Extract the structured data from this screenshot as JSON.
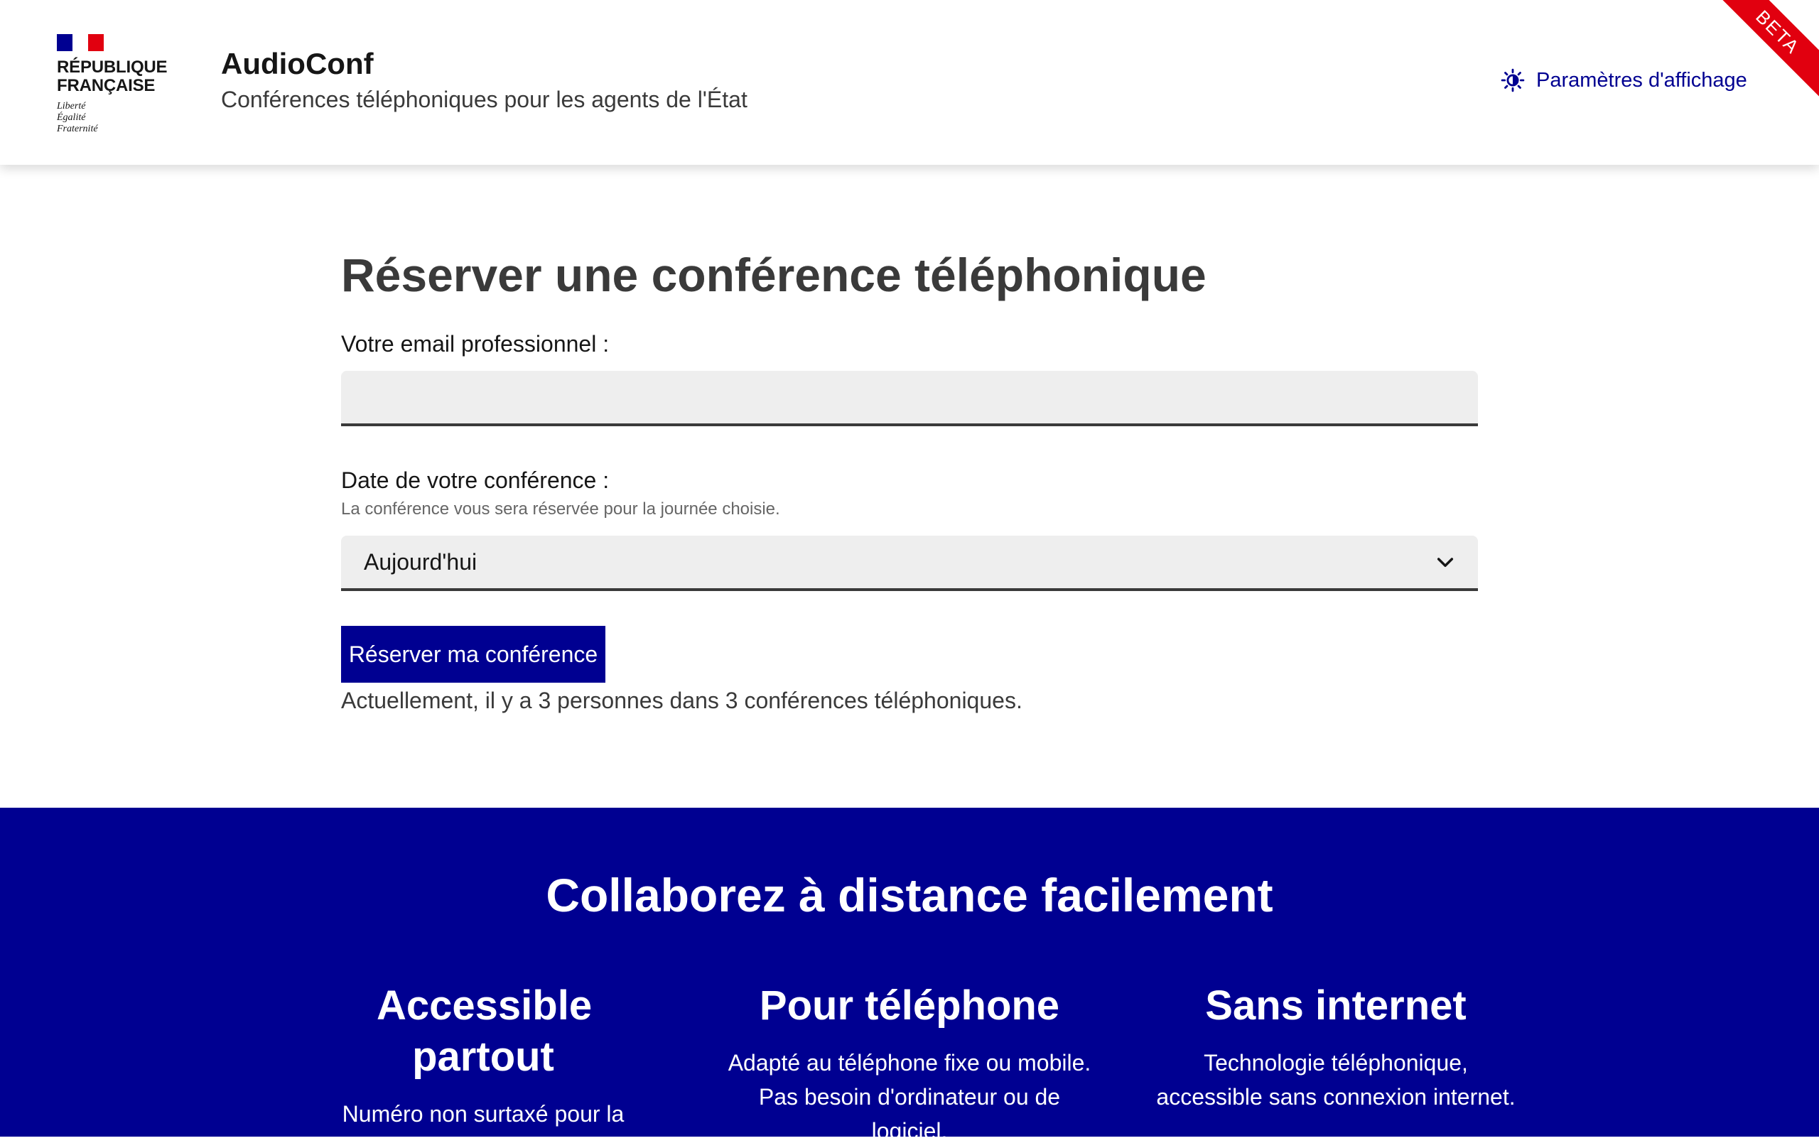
{
  "header": {
    "logo_text": "RÉPUBLIQUE FRANÇAISE",
    "logo_motto": [
      "Liberté",
      "Égalité",
      "Fraternité"
    ],
    "service_title": "AudioConf",
    "service_tagline": "Conférences téléphoniques pour les agents de l'État",
    "display_settings_label": "Paramètres d'affichage",
    "beta_label": "BETA"
  },
  "form": {
    "title": "Réserver une conférence téléphonique",
    "email_label": "Votre email professionnel :",
    "email_value": "",
    "date_label": "Date de votre conférence :",
    "date_hint": "La conférence vous sera réservée pour la journée choisie.",
    "date_selected": "Aujourd'hui",
    "submit_label": "Réserver ma conférence",
    "status_text": "Actuellement, il y a 3 personnes dans 3 conférences téléphoniques."
  },
  "features": {
    "title": "Collaborez à distance facilement",
    "items": [
      {
        "title": "Accessible partout",
        "text": "Numéro non surtaxé pour la"
      },
      {
        "title": "Pour téléphone",
        "text": "Adapté au téléphone fixe ou mobile. Pas besoin d'ordinateur ou de logiciel."
      },
      {
        "title": "Sans internet",
        "text": "Technologie téléphonique, accessible sans connexion internet."
      }
    ]
  },
  "colors": {
    "brand_blue": "#000091",
    "marianne_red": "#e1000f"
  }
}
